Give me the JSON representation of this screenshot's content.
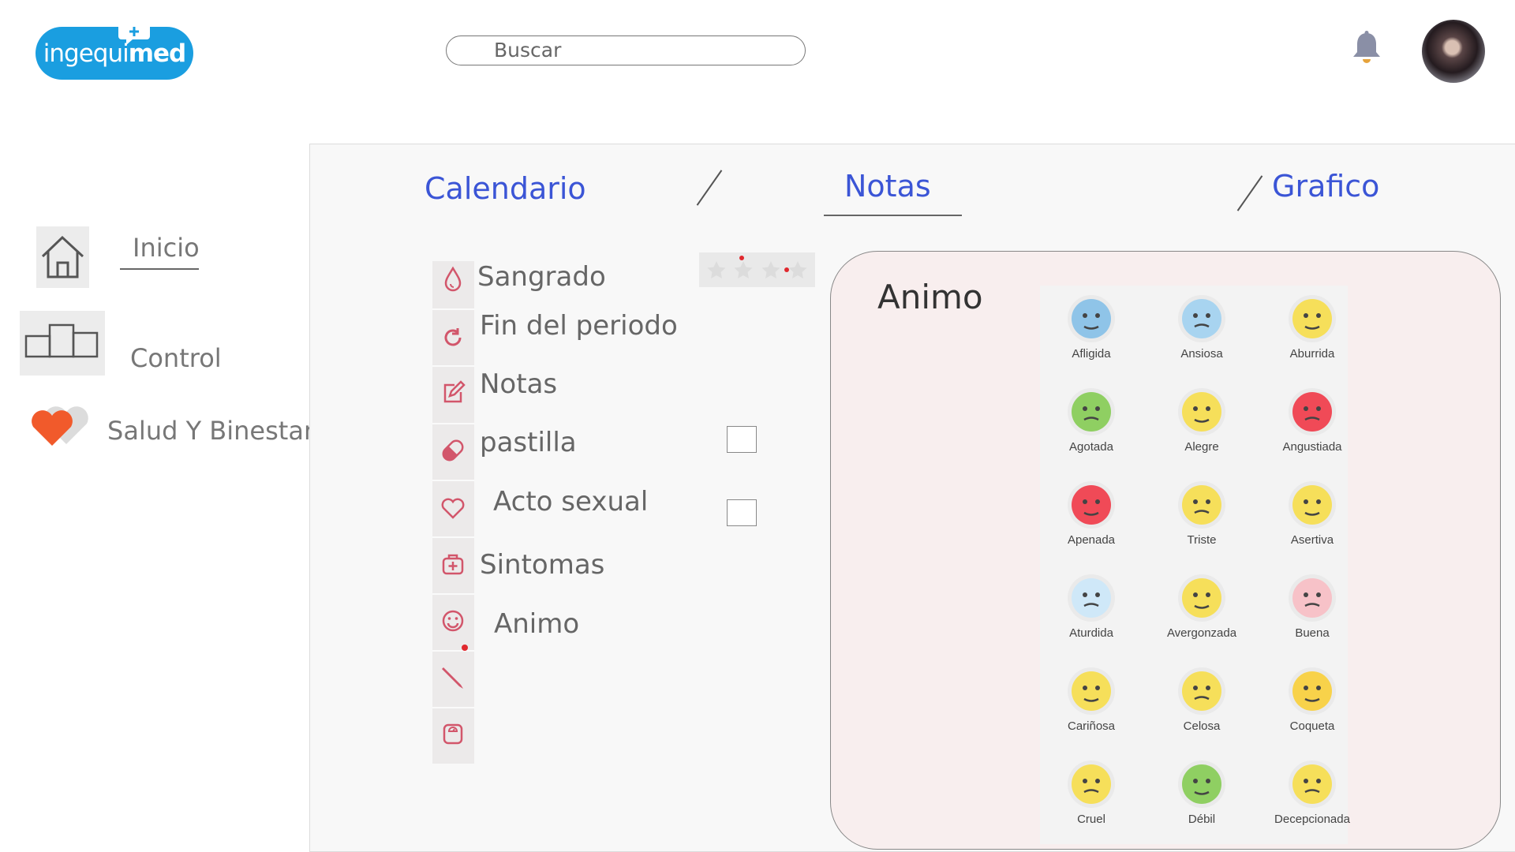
{
  "header": {
    "logo_part1": "ingequi",
    "logo_part2": "med",
    "search_placeholder": "Buscar"
  },
  "sidebar": {
    "items": [
      {
        "label": "Inicio",
        "icon": "home-icon"
      },
      {
        "label": "Control",
        "icon": "podium-icon"
      },
      {
        "label": "Salud Y Binestar",
        "icon": "hearts-icon"
      }
    ]
  },
  "tabs": [
    {
      "label": "Calendario"
    },
    {
      "label": "Notas",
      "active": true
    },
    {
      "label": "Grafico"
    }
  ],
  "menu": {
    "items": [
      {
        "label": "Sangrado",
        "icon": "drop-icon"
      },
      {
        "label": "Fin del periodo",
        "icon": "refresh-icon"
      },
      {
        "label": "Notas",
        "icon": "edit-icon"
      },
      {
        "label": "pastilla",
        "icon": "pill-icon"
      },
      {
        "label": "Acto sexual",
        "icon": "heart-icon"
      },
      {
        "label": "Sintomas",
        "icon": "medkit-icon"
      },
      {
        "label": "Animo",
        "icon": "smile-icon"
      },
      {
        "label": "",
        "icon": "pencil-icon"
      },
      {
        "label": "",
        "icon": "scale-icon"
      }
    ],
    "pastilla_checked": false,
    "acto_sexual_checked": false
  },
  "animo": {
    "title": "Animo",
    "moods": [
      {
        "label": "Afligida",
        "color": "#8fc4e8"
      },
      {
        "label": "Ansiosa",
        "color": "#a8d4f0"
      },
      {
        "label": "Aburrida",
        "color": "#f6df5a"
      },
      {
        "label": "Agotada",
        "color": "#8fcf62"
      },
      {
        "label": "Alegre",
        "color": "#f6df5a"
      },
      {
        "label": "Angustiada",
        "color": "#f04a57"
      },
      {
        "label": "Apenada",
        "color": "#f04a57"
      },
      {
        "label": "Triste",
        "color": "#f6df5a"
      },
      {
        "label": "Asertiva",
        "color": "#f6df5a"
      },
      {
        "label": "Aturdida",
        "color": "#cfe8f8"
      },
      {
        "label": "Avergonzada",
        "color": "#f6df5a"
      },
      {
        "label": "Buena",
        "color": "#f7c2c8"
      },
      {
        "label": "Cariñosa",
        "color": "#f6df5a"
      },
      {
        "label": "Celosa",
        "color": "#f6df5a"
      },
      {
        "label": "Coqueta",
        "color": "#f8d24a"
      },
      {
        "label": "Cruel",
        "color": "#f6df5a"
      },
      {
        "label": "Débil",
        "color": "#8fcf62"
      },
      {
        "label": "Decepcionada",
        "color": "#f6df5a"
      }
    ]
  }
}
